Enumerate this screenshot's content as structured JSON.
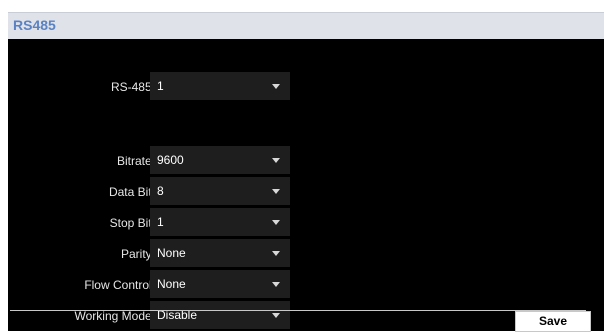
{
  "header": {
    "title": "RS485"
  },
  "form": {
    "rs485": {
      "label": "RS-485:",
      "value": "1"
    },
    "bitrate": {
      "label": "Bitrate:",
      "value": "9600"
    },
    "data_bit": {
      "label": "Data Bit:",
      "value": "8"
    },
    "stop_bit": {
      "label": "Stop Bit:",
      "value": "1"
    },
    "parity": {
      "label": "Parity:",
      "value": "None"
    },
    "flow_control": {
      "label": "Flow Control:",
      "value": "None"
    },
    "working_mode": {
      "label": "Working Mode:",
      "value": "Disable"
    }
  },
  "footer": {
    "save_label": "Save"
  },
  "icons": {
    "dropdown": "chevron-down-icon"
  },
  "colors": {
    "background": "#000000",
    "header_bg": "#dfe3e9",
    "title_accent": "#5b82c2",
    "select_bg": "#1e1e1e"
  }
}
